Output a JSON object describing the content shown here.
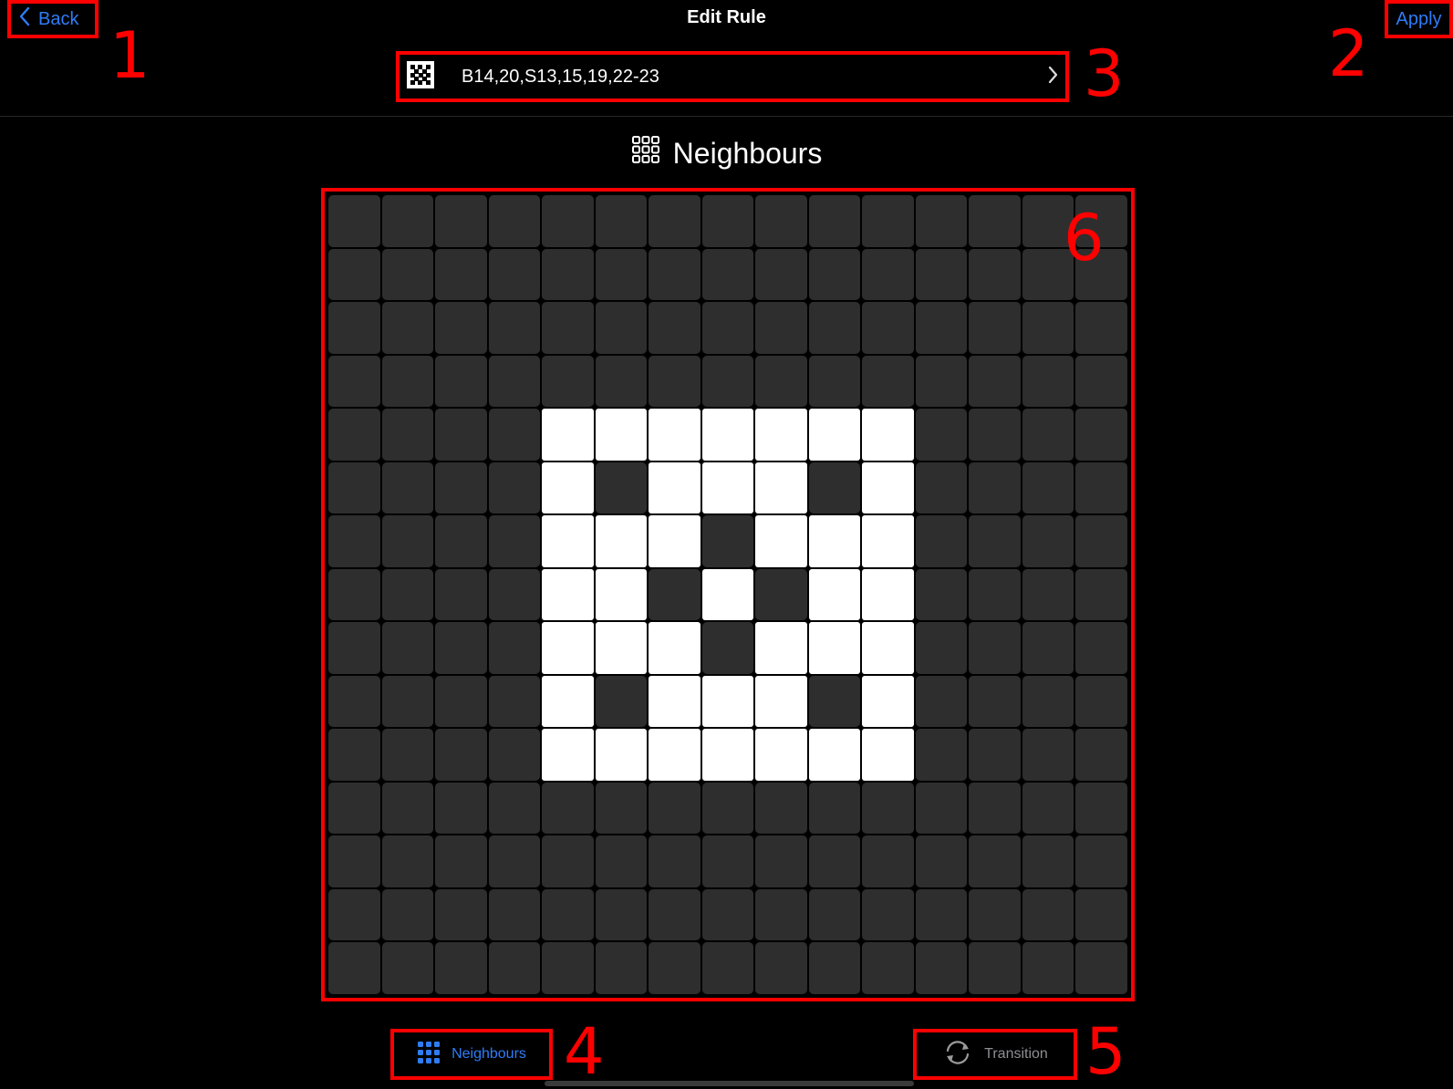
{
  "nav": {
    "back_label": "Back",
    "title": "Edit Rule",
    "apply_label": "Apply"
  },
  "rule": {
    "text": "B14,20,S13,15,19,22-23"
  },
  "section": {
    "title": "Neighbours"
  },
  "grid": {
    "rows": 15,
    "cols": 15,
    "on_cells": [
      [
        4,
        4
      ],
      [
        4,
        5
      ],
      [
        4,
        6
      ],
      [
        4,
        7
      ],
      [
        4,
        8
      ],
      [
        4,
        9
      ],
      [
        4,
        10
      ],
      [
        5,
        4
      ],
      [
        5,
        6
      ],
      [
        5,
        7
      ],
      [
        5,
        8
      ],
      [
        5,
        10
      ],
      [
        6,
        4
      ],
      [
        6,
        5
      ],
      [
        6,
        6
      ],
      [
        6,
        8
      ],
      [
        6,
        9
      ],
      [
        6,
        10
      ],
      [
        7,
        4
      ],
      [
        7,
        5
      ],
      [
        7,
        7
      ],
      [
        7,
        9
      ],
      [
        7,
        10
      ],
      [
        8,
        4
      ],
      [
        8,
        5
      ],
      [
        8,
        6
      ],
      [
        8,
        8
      ],
      [
        8,
        9
      ],
      [
        8,
        10
      ],
      [
        9,
        4
      ],
      [
        9,
        6
      ],
      [
        9,
        7
      ],
      [
        9,
        8
      ],
      [
        9,
        10
      ],
      [
        10,
        4
      ],
      [
        10,
        5
      ],
      [
        10,
        6
      ],
      [
        10,
        7
      ],
      [
        10,
        8
      ],
      [
        10,
        9
      ],
      [
        10,
        10
      ]
    ]
  },
  "tabs": {
    "neighbours_label": "Neighbours",
    "transition_label": "Transition"
  },
  "annotations": [
    "1",
    "2",
    "3",
    "4",
    "5",
    "6"
  ],
  "colors": {
    "accent": "#2f7cf6",
    "annotation": "#ff0000",
    "cell_off": "#2e2e2e",
    "cell_on": "#ffffff"
  },
  "icons": {
    "back": "chevron-left-icon",
    "rule": "rule-pattern-icon",
    "rule_arrow": "chevron-right-icon",
    "section": "grid-icon",
    "tab_neighbours": "grid-icon",
    "tab_transition": "refresh-icon"
  }
}
